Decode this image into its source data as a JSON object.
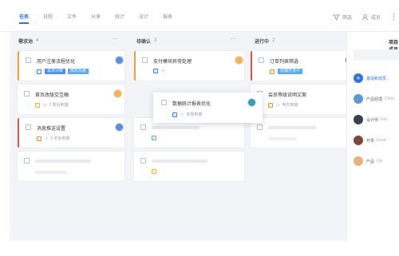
{
  "tabs": [
    "任务",
    "日程",
    "文件",
    "分享",
    "统计",
    "设计",
    "报表"
  ],
  "toolbar": {
    "filter_label": "筛选",
    "member_label": "成员"
  },
  "columns": [
    {
      "title": "需求池",
      "count": "4",
      "cards": [
        {
          "title": "用户注册流程优化",
          "tags": [
            "需求评审",
            "高优先级"
          ],
          "avatar": "blue"
        },
        {
          "title": "首页改版交互稿",
          "meta": "2 周后到期",
          "avatar": "orange"
        },
        {
          "title": "消息推送设置",
          "meta": "5 天后到期",
          "avatar": "blue"
        }
      ]
    },
    {
      "title": "待确认",
      "count": "3",
      "cards": [
        {
          "title": "支付模块异常处理",
          "meta": "",
          "avatar": "orange"
        }
      ],
      "floating": {
        "title": "数据统计报表优化",
        "meta": "本周到期",
        "avatar": "teal"
      }
    },
    {
      "title": "进行中",
      "count": "2",
      "cards": [
        {
          "title": "订单列表筛选",
          "tags": [
            "前端开发中"
          ],
          "avatar": "blue"
        },
        {
          "title": "会员等级说明文案",
          "meta": "明天到期"
        }
      ]
    }
  ],
  "side": {
    "title": "项目成员",
    "add_label": "邀请新成员",
    "members": [
      {
        "role": "产品经理",
        "name": "Chen"
      },
      {
        "role": "设计师",
        "name": "Eric"
      },
      {
        "role": "开发",
        "name": "Kevin"
      },
      {
        "role": "产品",
        "name": "Lily"
      }
    ]
  }
}
